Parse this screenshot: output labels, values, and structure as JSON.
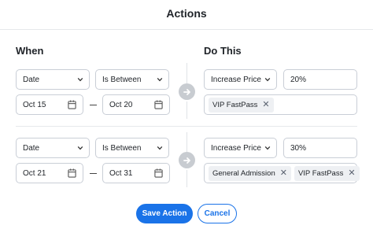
{
  "header": {
    "title": "Actions"
  },
  "columns": {
    "when": "When",
    "do_this": "Do This"
  },
  "rules": [
    {
      "field": "Date",
      "operator": "Is Between",
      "start_date": "Oct 15",
      "end_date": "Oct 20",
      "action": "Increase Price",
      "value": "20%",
      "targets": [
        "VIP FastPass"
      ]
    },
    {
      "field": "Date",
      "operator": "Is Between",
      "start_date": "Oct 21",
      "end_date": "Oct 31",
      "action": "Increase Price",
      "value": "30%",
      "targets": [
        "General Admission",
        "VIP FastPass"
      ]
    }
  ],
  "footer": {
    "save_label": "Save Action",
    "cancel_label": "Cancel"
  },
  "icons": {
    "dropdown": "chevron-down-icon",
    "date": "calendar-icon",
    "connector": "arrow-right-icon",
    "remove": "close-icon"
  },
  "colors": {
    "primary": "#1a73e8",
    "border": "#c9ced6",
    "chip_bg": "#eef0f3",
    "arrow_bg": "#c8ccd1"
  }
}
